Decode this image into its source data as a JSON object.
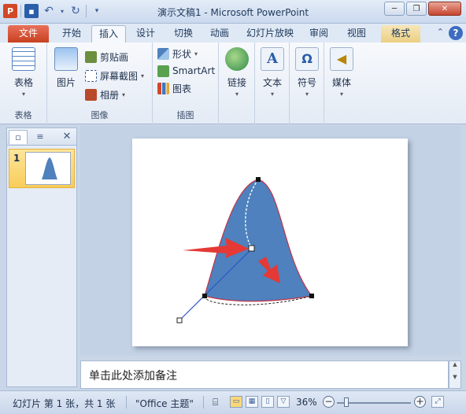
{
  "window": {
    "title": "演示文稿1 - Microsoft PowerPoint"
  },
  "qat": {
    "app_icon": "P"
  },
  "tabs": {
    "file": "文件",
    "home": "开始",
    "insert": "插入",
    "design": "设计",
    "transitions": "切换",
    "animations": "动画",
    "slideshow": "幻灯片放映",
    "review": "审阅",
    "view": "视图",
    "format": "格式",
    "help": "?"
  },
  "ribbon": {
    "tables": {
      "table": "表格",
      "group": "表格"
    },
    "images": {
      "picture": "图片",
      "clipart": "剪贴画",
      "screenshot": "屏幕截图",
      "album": "相册",
      "group": "图像"
    },
    "illustrations": {
      "shapes": "形状",
      "smartart": "SmartArt",
      "chart": "图表",
      "group": "插图"
    },
    "links": {
      "label": "链接"
    },
    "text": {
      "label": "文本"
    },
    "symbols": {
      "label": "符号"
    },
    "media": {
      "label": "媒体"
    }
  },
  "thumbnails": {
    "slide_number": "1"
  },
  "notes": {
    "placeholder": "单击此处添加备注"
  },
  "status": {
    "slide_info": "幻灯片 第 1 张，共 1 张",
    "theme": "\"Office 主题\"",
    "zoom": "36%"
  },
  "colors": {
    "shape_fill": "#4e81bd",
    "shape_outline": "#c0354a",
    "arrow": "#e53935",
    "handle_line": "#2d54c8",
    "file_tab": "#d24726"
  }
}
